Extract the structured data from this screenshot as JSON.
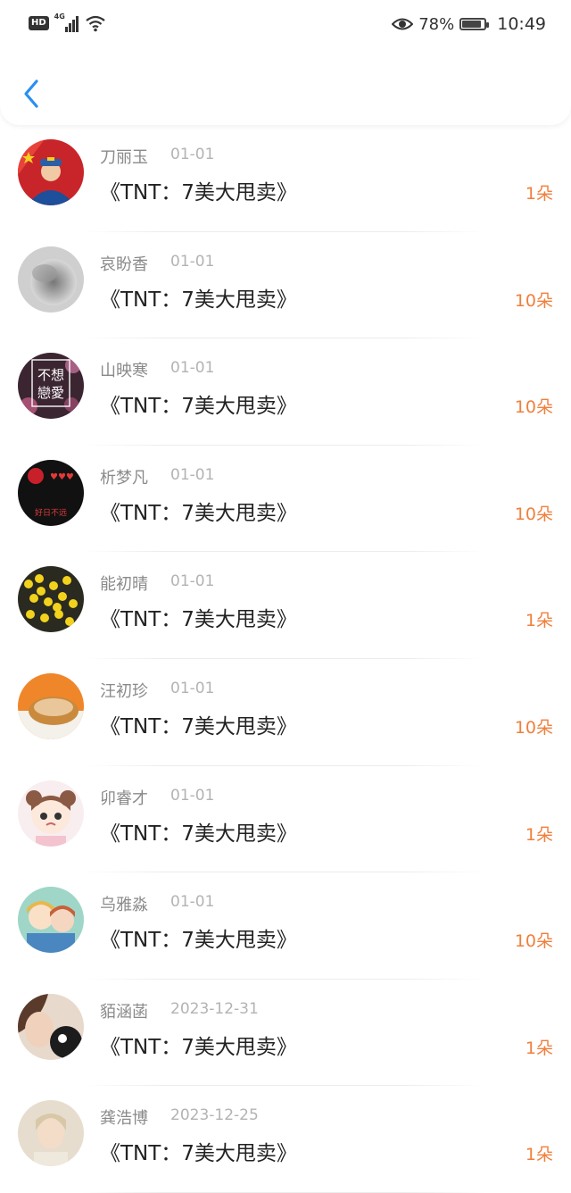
{
  "status_bar": {
    "badge": "HD",
    "network": "4G",
    "battery_percent": "78%",
    "battery_level": 0.78,
    "time": "10:49"
  },
  "colors": {
    "accent": "#2b8ff0",
    "amount": "#f07f3c"
  },
  "items": [
    {
      "name": "刀丽玉",
      "date": "01-01",
      "title": "《TNT：7美大甩卖》",
      "amount": "1朵",
      "avatar": "avatar-soldier"
    },
    {
      "name": "哀盼香",
      "date": "01-01",
      "title": "《TNT：7美大甩卖》",
      "amount": "10朵",
      "avatar": "avatar-grey-blur"
    },
    {
      "name": "山映寒",
      "date": "01-01",
      "title": "《TNT：7美大甩卖》",
      "amount": "10朵",
      "avatar": "avatar-text-image"
    },
    {
      "name": "析梦凡",
      "date": "01-01",
      "title": "《TNT：7美大甩卖》",
      "amount": "10朵",
      "avatar": "avatar-dark-heart"
    },
    {
      "name": "能初晴",
      "date": "01-01",
      "title": "《TNT：7美大甩卖》",
      "amount": "1朵",
      "avatar": "avatar-yellow-flowers"
    },
    {
      "name": "汪初珍",
      "date": "01-01",
      "title": "《TNT：7美大甩卖》",
      "amount": "10朵",
      "avatar": "avatar-bread"
    },
    {
      "name": "卯睿才",
      "date": "01-01",
      "title": "《TNT：7美大甩卖》",
      "amount": "1朵",
      "avatar": "avatar-cartoon-girl"
    },
    {
      "name": "乌雅淼",
      "date": "01-01",
      "title": "《TNT：7美大甩卖》",
      "amount": "10朵",
      "avatar": "avatar-anime-pair"
    },
    {
      "name": "貊涵菡",
      "date": "2023-12-31",
      "title": "《TNT：7美大甩卖》",
      "amount": "1朵",
      "avatar": "avatar-girl-cat"
    },
    {
      "name": "龚浩博",
      "date": "2023-12-25",
      "title": "《TNT：7美大甩卖》",
      "amount": "1朵",
      "avatar": "avatar-girl-portrait"
    }
  ],
  "avatar_text": {
    "line1": "不想",
    "line2": "戀愛"
  },
  "avatar_caption": "好日不远",
  "avatar_heart_text": "♥♥♥"
}
